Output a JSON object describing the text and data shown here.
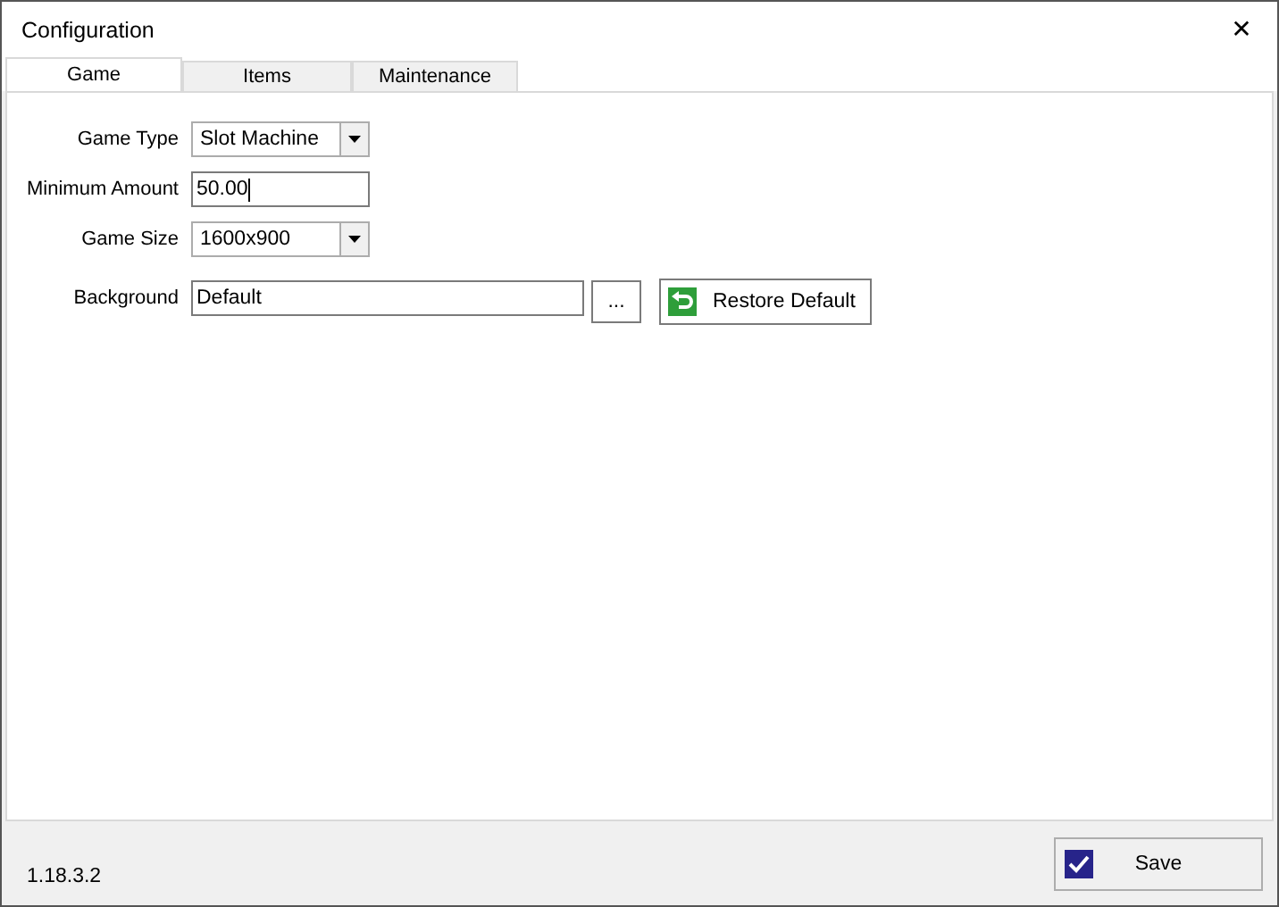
{
  "window": {
    "title": "Configuration",
    "close": "✕"
  },
  "tabs": [
    {
      "label": "Game",
      "selected": true
    },
    {
      "label": "Items",
      "selected": false
    },
    {
      "label": "Maintenance",
      "selected": false
    }
  ],
  "fields": [
    {
      "kind": "combo",
      "label": "Game Type",
      "value": "Slot Machine"
    },
    {
      "kind": "text",
      "label": "Minimum Amount",
      "value": "50.00"
    },
    {
      "kind": "combo",
      "label": "Game Size",
      "value": "1600x900"
    },
    {
      "kind": "file",
      "label": "Background",
      "value": "Default",
      "browse": "...",
      "restore": "Restore Default"
    }
  ],
  "footer": {
    "version": "1.18.3.2",
    "save": "Save"
  }
}
